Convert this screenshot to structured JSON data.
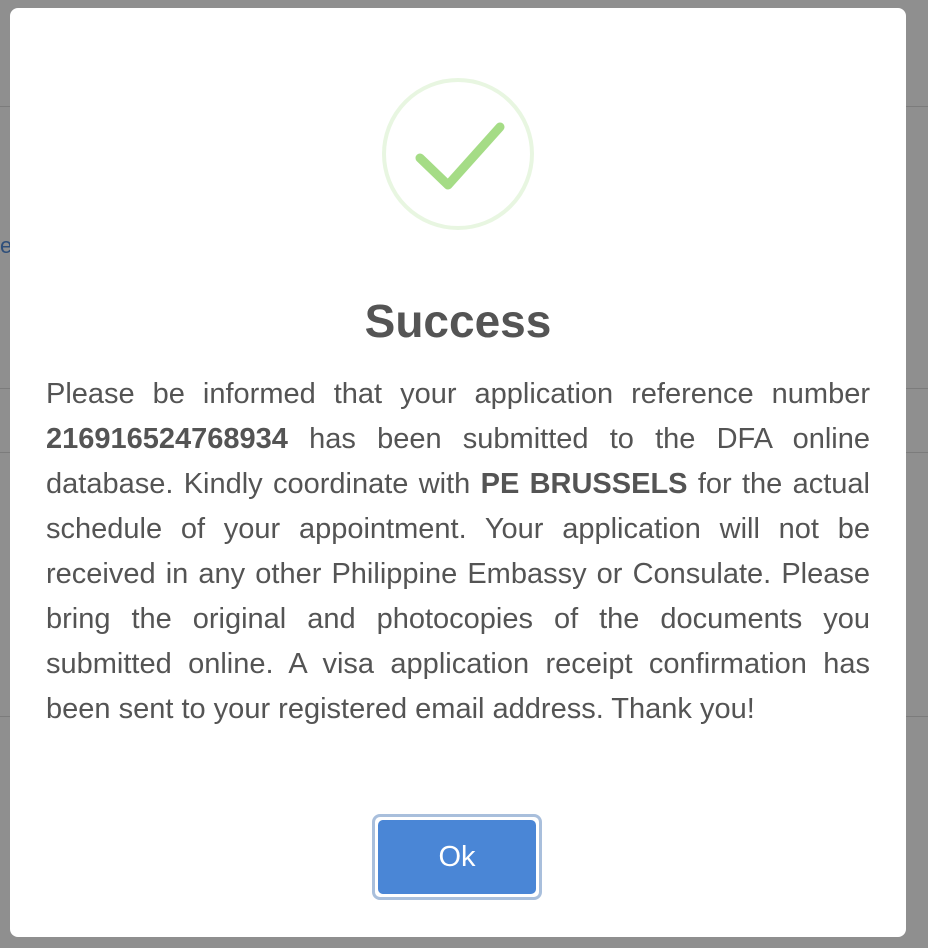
{
  "background": {
    "partial_text": "e"
  },
  "dialog": {
    "icon": "checkmark-circle-icon",
    "title": "Success",
    "message": {
      "p1": "Please be informed that your application reference number ",
      "reference_number": "216916524768934",
      "p2": " has been submitted to the DFA online database. Kindly coordinate with ",
      "post": "PE BRUSSELS",
      "p3": " for the actual schedule of your appointment. Your application will not be received in any other Philippine Embassy or Consulate. Please bring the original and photocopies of the documents you submitted online. A visa application receipt confirmation has been sent to your registered email address. Thank you!"
    },
    "ok_label": "Ok"
  },
  "colors": {
    "success_green": "#a5dc86",
    "button_blue": "#4a86d6",
    "text": "#545454"
  }
}
